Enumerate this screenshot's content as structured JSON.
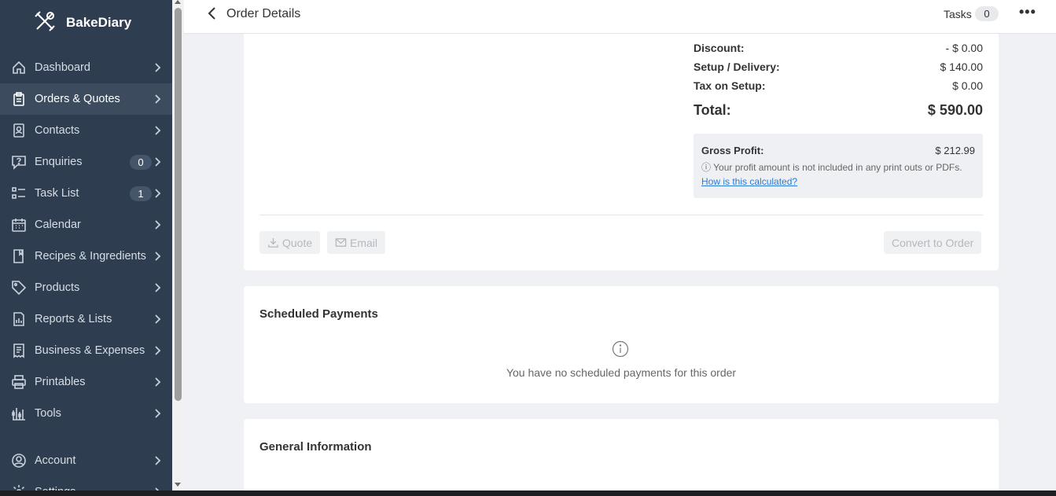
{
  "app": {
    "name": "BakeDiary"
  },
  "sidebar": {
    "items": [
      {
        "label": "Dashboard",
        "icon": "home-icon"
      },
      {
        "label": "Orders & Quotes",
        "icon": "clipboard-icon",
        "active": true
      },
      {
        "label": "Contacts",
        "icon": "contact-book-icon"
      },
      {
        "label": "Enquiries",
        "icon": "question-chat-icon",
        "count": "0"
      },
      {
        "label": "Task List",
        "icon": "checklist-icon",
        "count": "1"
      },
      {
        "label": "Calendar",
        "icon": "calendar-icon"
      },
      {
        "label": "Recipes & Ingredients",
        "icon": "recipe-book-icon"
      },
      {
        "label": "Products",
        "icon": "tag-icon"
      },
      {
        "label": "Reports & Lists",
        "icon": "report-icon"
      },
      {
        "label": "Business & Expenses",
        "icon": "receipt-icon"
      },
      {
        "label": "Printables",
        "icon": "printer-icon"
      },
      {
        "label": "Tools",
        "icon": "tools-icon"
      },
      {
        "label": "Account",
        "icon": "account-icon"
      },
      {
        "label": "Settings",
        "icon": "settings-icon"
      }
    ]
  },
  "header": {
    "title": "Order Details",
    "tasks_label": "Tasks",
    "tasks_count": "0"
  },
  "summary": {
    "discount_label": "Discount:",
    "discount_value": "- $ 0.00",
    "setup_label": "Setup / Delivery:",
    "setup_value": "$ 140.00",
    "tax_label": "Tax on Setup:",
    "tax_value": "$ 0.00",
    "total_label": "Total:",
    "total_value": "$ 590.00",
    "gross_profit_label": "Gross Profit:",
    "gross_profit_value": "$ 212.99",
    "profit_note": "Your profit amount is not included in any print outs or PDFs.",
    "profit_link": "How is this calculated?"
  },
  "actions": {
    "quote_label": "Quote",
    "email_label": "Email",
    "convert_label": "Convert to Order"
  },
  "scheduled_payments": {
    "title": "Scheduled Payments",
    "empty_text": "You have no scheduled payments for this order"
  },
  "general_information": {
    "title": "General Information"
  }
}
